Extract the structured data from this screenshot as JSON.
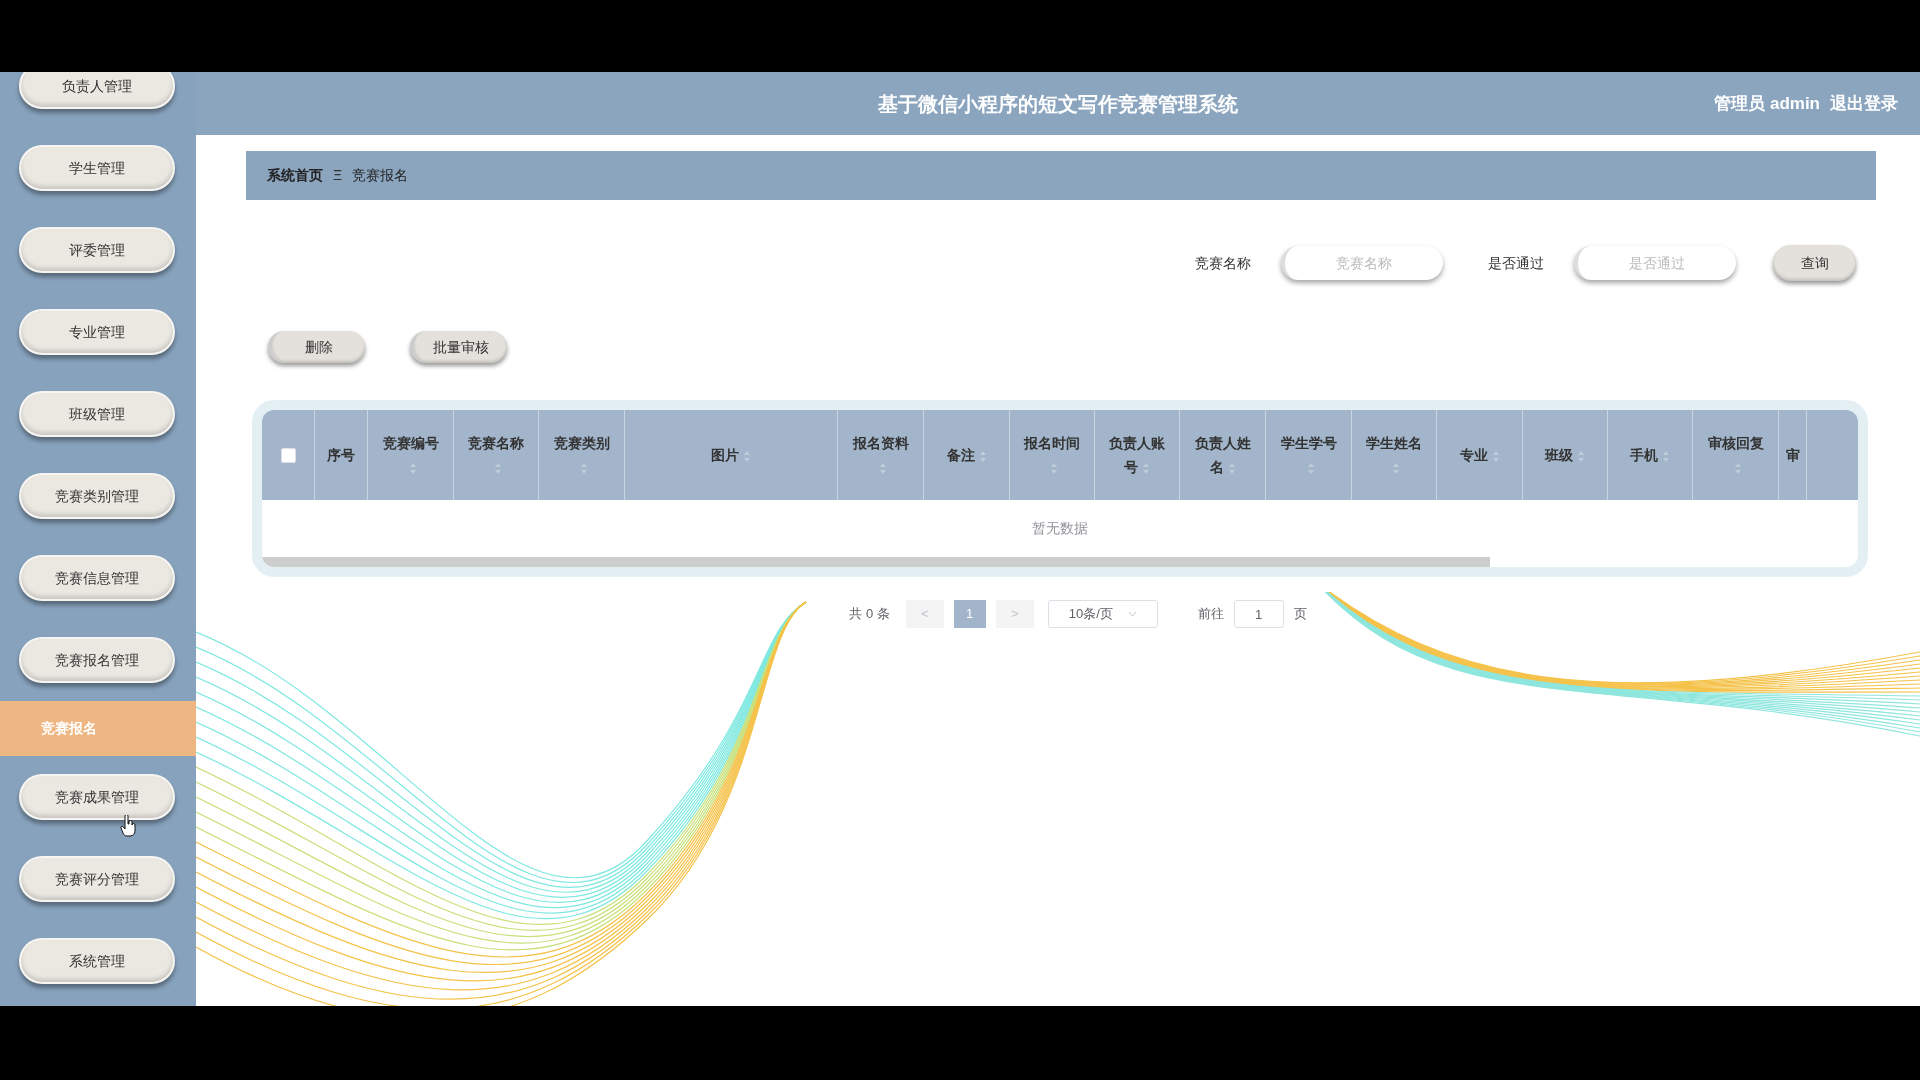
{
  "sidebar": {
    "items": [
      {
        "label": "负责人管理",
        "selected": false
      },
      {
        "label": "学生管理",
        "selected": false
      },
      {
        "label": "评委管理",
        "selected": false
      },
      {
        "label": "专业管理",
        "selected": false
      },
      {
        "label": "班级管理",
        "selected": false
      },
      {
        "label": "竞赛类别管理",
        "selected": false
      },
      {
        "label": "竞赛信息管理",
        "selected": false
      },
      {
        "label": "竞赛报名管理",
        "selected": false
      },
      {
        "label": "竞赛报名",
        "selected": true
      },
      {
        "label": "竞赛成果管理",
        "selected": false
      },
      {
        "label": "竞赛评分管理",
        "selected": false
      },
      {
        "label": "系统管理",
        "selected": false
      }
    ]
  },
  "header": {
    "title": "基于微信小程序的短文写作竞赛管理系统",
    "user": "管理员 admin",
    "logout": "退出登录"
  },
  "breadcrumb": {
    "home": "系统首页",
    "separator": "Ξ",
    "current": "竞赛报名"
  },
  "search": {
    "fields": [
      {
        "label": "竞赛名称",
        "placeholder": "竞赛名称"
      },
      {
        "label": "是否通过",
        "placeholder": "是否通过"
      }
    ],
    "button": "查询"
  },
  "actions": [
    "删除",
    "批量审核"
  ],
  "table": {
    "select_all_checked": false,
    "columns": [
      {
        "label": "序号",
        "sortable": false
      },
      {
        "label": "竞赛编号",
        "sortable": true
      },
      {
        "label": "竞赛名称",
        "sortable": true
      },
      {
        "label": "竞赛类别",
        "sortable": true
      },
      {
        "label": "图片",
        "sortable": true
      },
      {
        "label": "报名资料",
        "sortable": true
      },
      {
        "label": "备注",
        "sortable": true
      },
      {
        "label": "报名时间",
        "sortable": true
      },
      {
        "label": "负责人账号",
        "sortable": true
      },
      {
        "label": "负责人姓名",
        "sortable": true
      },
      {
        "label": "学生学号",
        "sortable": true
      },
      {
        "label": "学生姓名",
        "sortable": true
      },
      {
        "label": "专业",
        "sortable": true
      },
      {
        "label": "班级",
        "sortable": true
      },
      {
        "label": "手机",
        "sortable": true
      },
      {
        "label": "审核回复",
        "sortable": true
      },
      {
        "label": "审",
        "sortable": false
      }
    ],
    "empty_text": "暂无数据"
  },
  "pagination": {
    "total": "共 0 条",
    "prev": "<",
    "pages": [
      {
        "label": "1",
        "selected": true
      }
    ],
    "next": ">",
    "page_size": "10条/页",
    "goto_label": "前往",
    "goto_value": "1",
    "goto_suffix": "页"
  }
}
